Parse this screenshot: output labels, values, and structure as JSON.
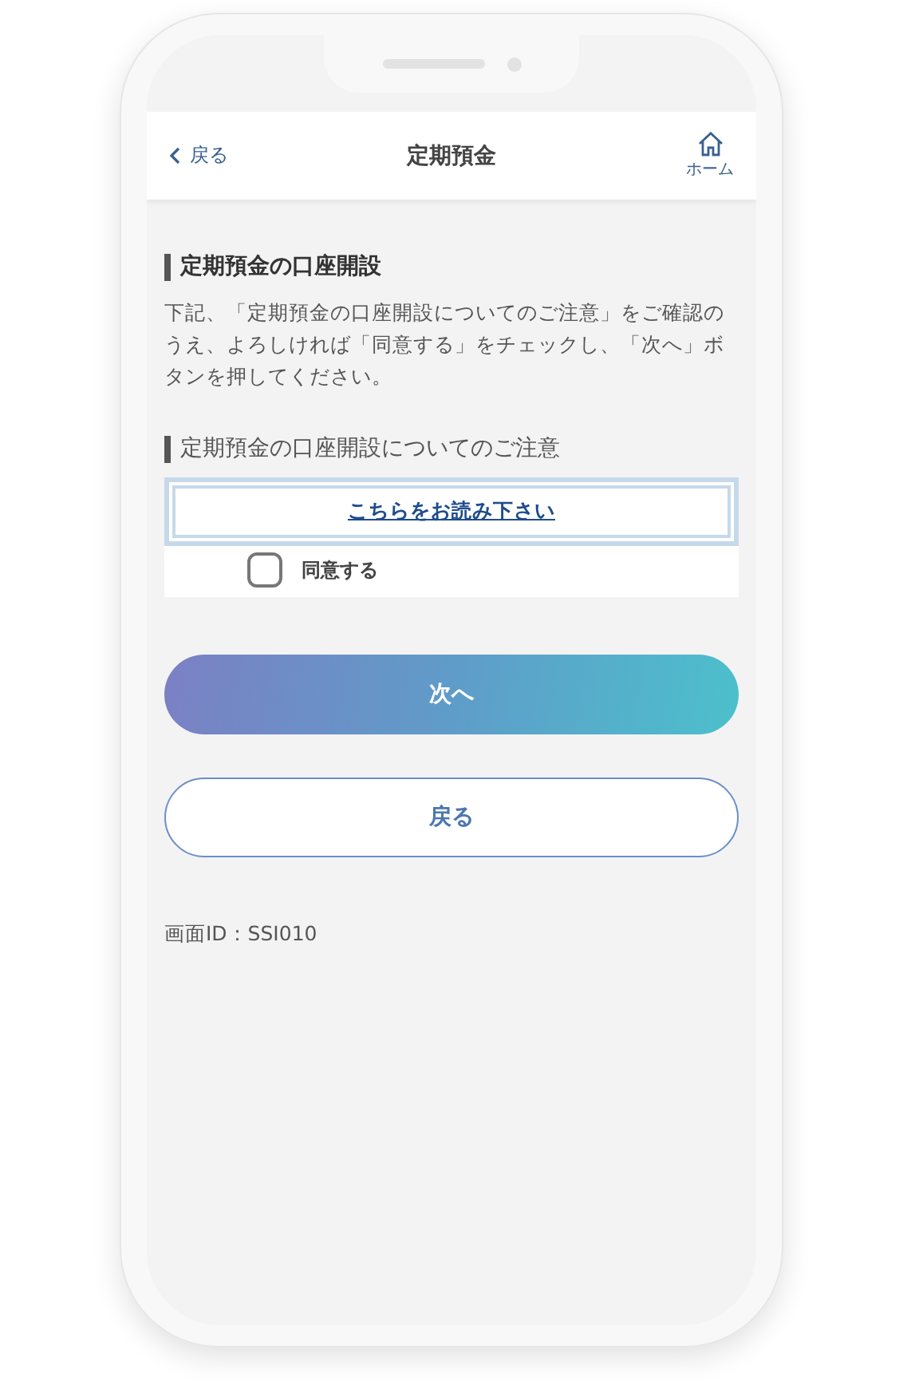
{
  "header": {
    "back_label": "戻る",
    "title": "定期預金",
    "home_label": "ホーム"
  },
  "section": {
    "heading": "定期預金の口座開設",
    "description": "下記、「定期預金の口座開設についてのご注意」をご確認のうえ、よろしければ「同意する」をチェックし、「次へ」ボタンを押してください。"
  },
  "notice": {
    "heading": "定期預金の口座開設についてのご注意",
    "link": "こちらをお読み下さい",
    "agree": {
      "label": "同意する",
      "checked": false
    }
  },
  "buttons": [
    {
      "label": "次へ",
      "kind": "primary"
    },
    {
      "label": "戻る",
      "kind": "secondary"
    }
  ],
  "screen_id": "画面ID：SSI010"
}
